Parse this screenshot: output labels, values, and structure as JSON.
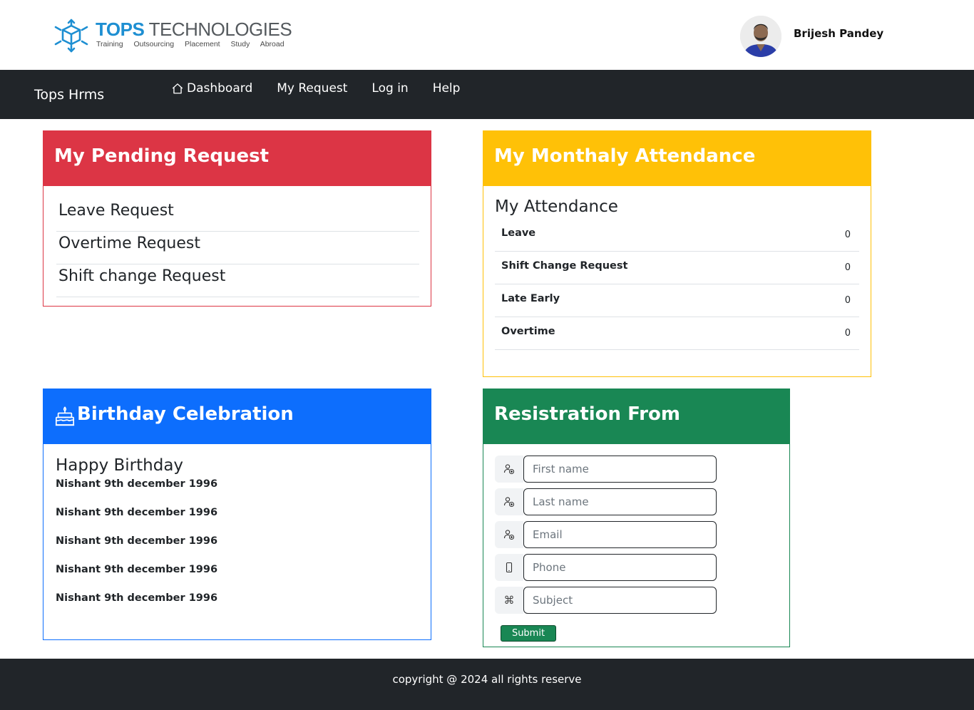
{
  "header": {
    "logo": {
      "name_a": "TOPS",
      "name_b": " TECHNOLOGIES",
      "tagline": "Training Outsourcing Placement Study Abroad"
    },
    "user": {
      "name": "Brijesh Pandey"
    }
  },
  "navbar": {
    "brand": "Tops Hrms",
    "items": [
      {
        "label": "Dashboard",
        "icon": "home-icon"
      },
      {
        "label": "My Request"
      },
      {
        "label": "Log in"
      },
      {
        "label": "Help"
      }
    ]
  },
  "pending": {
    "title": "My Pending Request",
    "items": [
      "Leave Request",
      "Overtime Request",
      "Shift change Request"
    ]
  },
  "attendance": {
    "title": "My Monthaly Attendance",
    "subtitle": "My Attendance",
    "rows": [
      {
        "label": "Leave",
        "value": "0"
      },
      {
        "label": "Shift Change Request",
        "value": "0"
      },
      {
        "label": "Late Early",
        "value": "0"
      },
      {
        "label": "Overtime",
        "value": "0"
      }
    ]
  },
  "birthday": {
    "title": "Birthday Celebration",
    "subtitle": "Happy Birthday",
    "items": [
      "Nishant 9th december 1996",
      "Nishant 9th december 1996",
      "Nishant 9th december 1996",
      "Nishant 9th december 1996",
      "Nishant 9th december 1996"
    ]
  },
  "registration": {
    "title": "Resistration From",
    "fields": [
      {
        "placeholder": "First name",
        "icon": "person-add-icon"
      },
      {
        "placeholder": "Last name",
        "icon": "person-add-icon"
      },
      {
        "placeholder": "Email",
        "icon": "person-add-icon"
      },
      {
        "placeholder": "Phone",
        "icon": "phone-icon"
      },
      {
        "placeholder": "Subject",
        "icon": "command-icon"
      }
    ],
    "submit_label": "Submit"
  },
  "footer": {
    "text": "copyright @ 2024 all rights reserve"
  },
  "colors": {
    "navbar": "#212529",
    "danger": "#dc3545",
    "warning": "#ffc107",
    "primary": "#0d6efd",
    "success": "#198754"
  }
}
